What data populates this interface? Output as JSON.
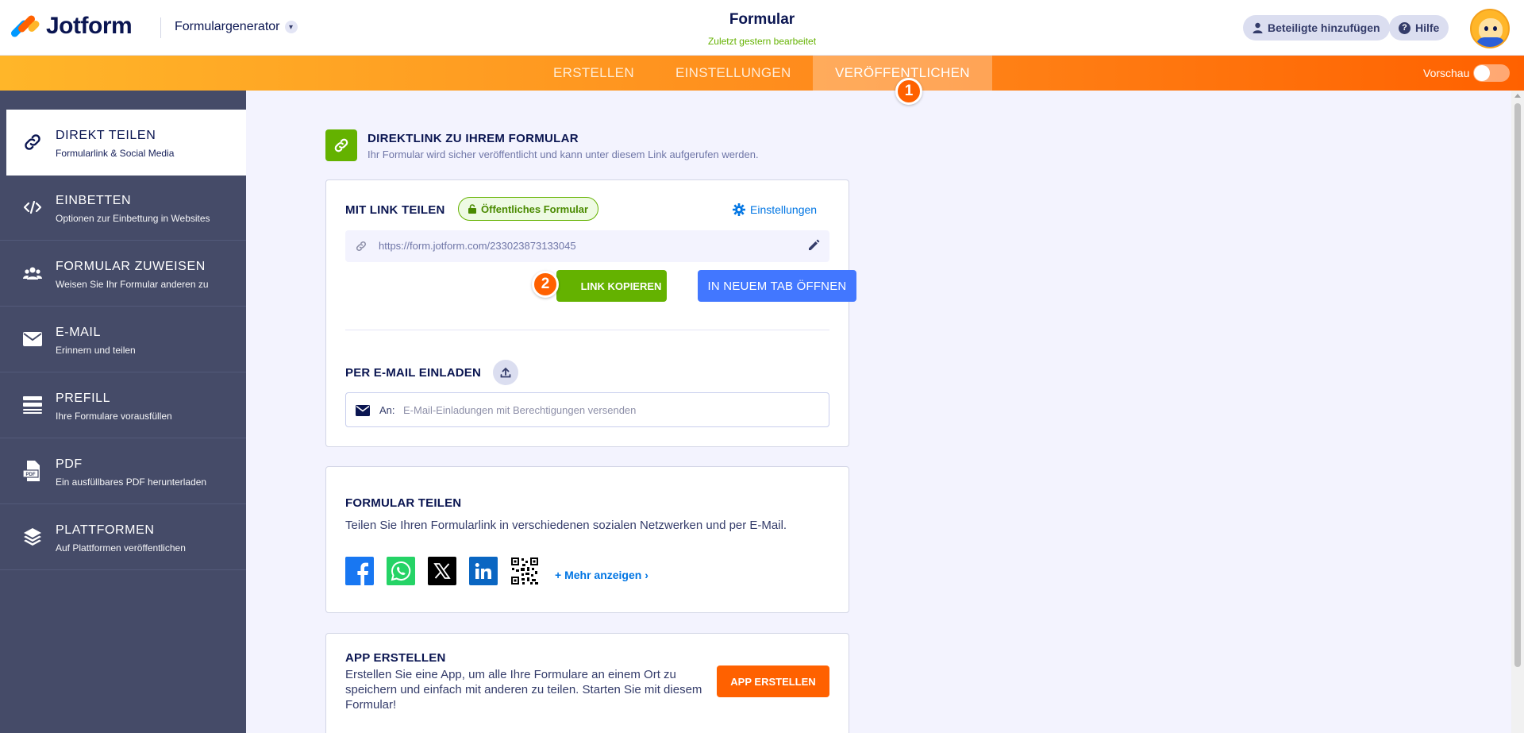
{
  "header": {
    "brand": "Jotform",
    "form_generator": "Formulargenerator",
    "form_title": "Formular",
    "last_edited": "Zuletzt gestern bearbeitet",
    "invite_label": "Beteiligte hinzufügen",
    "help_label": "Hilfe"
  },
  "tabs": {
    "create": "ERSTELLEN",
    "settings": "EINSTELLUNGEN",
    "publish": "VERÖFFENTLICHEN",
    "preview_label": "Vorschau"
  },
  "badges": {
    "one": "1",
    "two": "2"
  },
  "sidebar": {
    "items": [
      {
        "title": "DIREKT TEILEN",
        "sub": "Formularlink & Social Media",
        "icon": "link-icon"
      },
      {
        "title": "EINBETTEN",
        "sub": "Optionen zur Einbettung in Websites",
        "icon": "code-icon"
      },
      {
        "title": "FORMULAR ZUWEISEN",
        "sub": "Weisen Sie Ihr Formular anderen zu",
        "icon": "users-icon"
      },
      {
        "title": "E-MAIL",
        "sub": "Erinnern und teilen",
        "icon": "envelope-icon"
      },
      {
        "title": "PREFILL",
        "sub": "Ihre Formulare vorausfüllen",
        "icon": "prefill-icon"
      },
      {
        "title": "PDF",
        "sub": "Ein ausfüllbares PDF herunterladen",
        "icon": "pdf-icon"
      },
      {
        "title": "PLATTFORMEN",
        "sub": "Auf Plattformen veröffentlichen",
        "icon": "layers-icon"
      }
    ]
  },
  "direct": {
    "title": "DIREKTLINK ZU IHREM FORMULAR",
    "sub": "Ihr Formular wird sicher veröffentlicht und kann unter diesem Link aufgerufen werden."
  },
  "share_link": {
    "title": "MIT LINK TEILEN",
    "public_label": "Öffentliches Formular",
    "settings_label": "Einstellungen",
    "url": "https://form.jotform.com/233023873133045",
    "copy_label": "LINK KOPIEREN",
    "newtab_label": "IN NEUEM TAB ÖFFNEN"
  },
  "email_invite": {
    "title": "PER E-MAIL EINLADEN",
    "to_label": "An:",
    "placeholder": "E-Mail-Einladungen mit Berechtigungen versenden"
  },
  "share_form": {
    "title": "FORMULAR TEILEN",
    "sub": "Teilen Sie Ihren Formularlink in verschiedenen sozialen Netzwerken und per E-Mail.",
    "more_label": "+ Mehr anzeigen ›"
  },
  "app": {
    "title": "APP ERSTELLEN",
    "text": "Erstellen Sie eine App, um alle Ihre Formulare an einem Ort zu speichern und einfach mit anderen zu teilen. Starten Sie mit diesem Formular!",
    "button_label": "APP ERSTELLEN"
  },
  "colors": {
    "accent_orange": "#ff6100",
    "green": "#64b200",
    "blue": "#4277ff",
    "sidebar": "#454b68",
    "navy": "#0a1551"
  }
}
